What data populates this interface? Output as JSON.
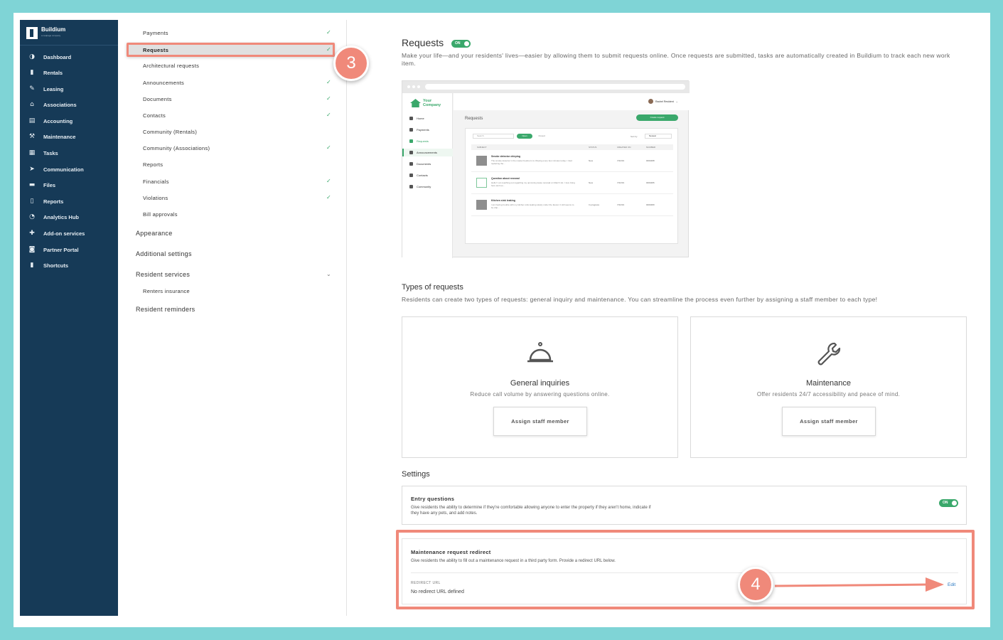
{
  "brand": {
    "name": "Buildium",
    "tagline": "a realpage company"
  },
  "nav": [
    {
      "label": "Dashboard",
      "icon": "dashboard-icon"
    },
    {
      "label": "Rentals",
      "icon": "building-icon"
    },
    {
      "label": "Leasing",
      "icon": "leasing-icon"
    },
    {
      "label": "Associations",
      "icon": "home-icon"
    },
    {
      "label": "Accounting",
      "icon": "calculator-icon"
    },
    {
      "label": "Maintenance",
      "icon": "wrench-icon"
    },
    {
      "label": "Tasks",
      "icon": "clipboard-icon"
    },
    {
      "label": "Communication",
      "icon": "send-icon"
    },
    {
      "label": "Files",
      "icon": "folder-icon"
    },
    {
      "label": "Reports",
      "icon": "report-icon"
    },
    {
      "label": "Analytics Hub",
      "icon": "analytics-icon"
    },
    {
      "label": "Add-on services",
      "icon": "puzzle-icon"
    },
    {
      "label": "Partner Portal",
      "icon": "partner-icon"
    },
    {
      "label": "Shortcuts",
      "icon": "bookmark-icon"
    }
  ],
  "settings": {
    "subitems": [
      {
        "label": "Payments",
        "checked": true
      },
      {
        "label": "Requests",
        "checked": true,
        "selected": true
      },
      {
        "label": "Architectural requests",
        "checked": false
      },
      {
        "label": "Announcements",
        "checked": true
      },
      {
        "label": "Documents",
        "checked": true
      },
      {
        "label": "Contacts",
        "checked": true
      },
      {
        "label": "Community (Rentals)",
        "checked": false
      },
      {
        "label": "Community (Associations)",
        "checked": true
      },
      {
        "label": "Reports",
        "checked": false
      },
      {
        "label": "Financials",
        "checked": true
      },
      {
        "label": "Violations",
        "checked": true
      },
      {
        "label": "Bill approvals",
        "checked": false
      }
    ],
    "appearance": "Appearance",
    "additional": "Additional settings",
    "resident_services": "Resident services",
    "renters_insurance": "Renters insurance",
    "resident_reminders": "Resident reminders"
  },
  "callouts": {
    "step3": "3",
    "step4": "4"
  },
  "requests": {
    "title": "Requests",
    "toggle": "ON",
    "description": "Make your life—and your residents' lives—easier by allowing them to submit requests online. Once requests are submitted, tasks are automatically created in Buildium to track each new work item."
  },
  "preview": {
    "company_line1": "Your",
    "company_line2": "Company",
    "user": "Rachel Resident",
    "nav": [
      "Home",
      "Payments",
      "Requests",
      "Announcements",
      "Documents",
      "Contacts",
      "Community"
    ],
    "page_title": "Requests",
    "create_button": "Create request",
    "search": "Search",
    "tab_open": "Open",
    "tab_closed": "Closed",
    "sort_label": "Sort by",
    "sort_value": "Newest",
    "headers": [
      "SUBJECT",
      "STATUS",
      "CREATED ON",
      "NUMBER"
    ],
    "rows": [
      {
        "title": "Smoke detector chirping",
        "desc": "The smoke detector in the master bedroom is chirping every few minutes today. I tried replacing the...",
        "status": "New",
        "date": "7/22/19",
        "number": "0000488"
      },
      {
        "title": "Question about renewal",
        "desc": "Hello! I am reaching out regarding my upcoming lease renewal on March 1st. I love living here and wo...",
        "status": "New",
        "date": "7/22/19",
        "number": "0000486"
      },
      {
        "title": "Kitchen sink leaking",
        "desc": "I am having trouble with my kitchen sink leaking slowly under the faucet. It still seems to be drip...",
        "status": "In progress",
        "date": "7/22/19",
        "number": "0000480"
      }
    ]
  },
  "types": {
    "title": "Types of requests",
    "description": "Residents can create two types of requests: general inquiry and maintenance. You can streamline the process even further by assigning a staff member to each type!",
    "cards": [
      {
        "title": "General inquiries",
        "desc": "Reduce call volume by answering questions online.",
        "button": "Assign staff member",
        "icon": "service-bell-icon"
      },
      {
        "title": "Maintenance",
        "desc": "Offer residents 24/7 accessibility and peace of mind.",
        "button": "Assign staff member",
        "icon": "wrench-icon"
      }
    ]
  },
  "settings_section": {
    "title": "Settings",
    "entry_title": "Entry questions",
    "entry_desc": "Give residents the ability to determine if they're comfortable allowing anyone to enter the property if they aren't home, indicate if they have any pets, and add notes.",
    "entry_toggle": "ON",
    "redirect_title": "Maintenance request redirect",
    "redirect_desc": "Give residents the ability to fill out a maintenance request in a third party form. Provide a redirect URL below.",
    "redirect_label": "REDIRECT URL",
    "redirect_value": "No redirect URL defined",
    "edit_link": "Edit"
  }
}
